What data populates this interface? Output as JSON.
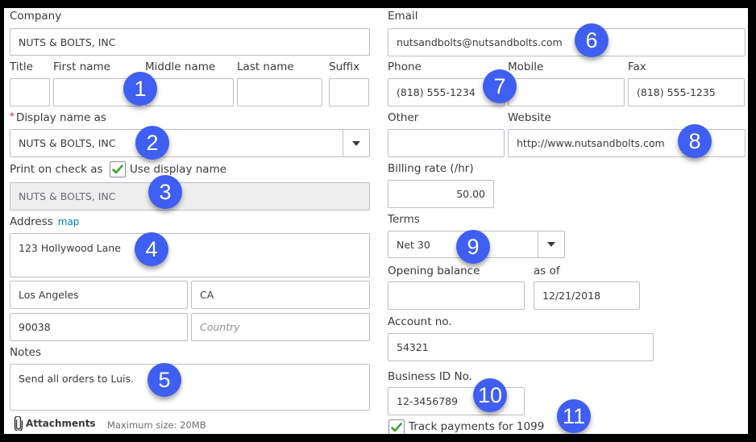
{
  "left": {
    "company": {
      "label": "Company",
      "value": "NUTS & BOLTS, INC"
    },
    "name_labels": {
      "title": "Title",
      "first": "First name",
      "middle": "Middle name",
      "last": "Last name",
      "suffix": "Suffix"
    },
    "name_values": {
      "title": "",
      "first": "",
      "middle": "",
      "last": "",
      "suffix": ""
    },
    "display_name": {
      "required_mark": "*",
      "label": "Display name as",
      "value": "NUTS & BOLTS, INC"
    },
    "print_on_check": {
      "label": "Print on check as",
      "checkbox_checked": true,
      "checkbox_label": "Use display name",
      "value": "NUTS & BOLTS, INC"
    },
    "address": {
      "label": "Address",
      "map_link": "map",
      "street": "123 Hollywood Lane",
      "city": "Los Angeles",
      "state": "CA",
      "zip": "90038",
      "country_placeholder": "Country"
    },
    "notes": {
      "label": "Notes",
      "value": "Send all orders to Luis."
    },
    "attachments": {
      "label": "Attachments",
      "max_size": "Maximum size: 20MB"
    }
  },
  "right": {
    "email": {
      "label": "Email",
      "value": "nutsandbolts@nutsandbolts.com"
    },
    "phone": {
      "label": "Phone",
      "value": "(818) 555-1234"
    },
    "mobile": {
      "label": "Mobile",
      "value": ""
    },
    "fax": {
      "label": "Fax",
      "value": "(818) 555-1235"
    },
    "other": {
      "label": "Other",
      "value": ""
    },
    "website": {
      "label": "Website",
      "value": "http://www.nutsandbolts.com"
    },
    "billing_rate": {
      "label": "Billing rate (/hr)",
      "value": "50.00"
    },
    "terms": {
      "label": "Terms",
      "value": "Net 30"
    },
    "opening_balance": {
      "label": "Opening balance",
      "value": ""
    },
    "as_of": {
      "label": "as of",
      "value": "12/21/2018"
    },
    "account_no": {
      "label": "Account no.",
      "value": "54321"
    },
    "business_id": {
      "label": "Business ID No.",
      "value": "12-3456789"
    },
    "track_1099": {
      "checked": true,
      "label": "Track payments for 1099"
    }
  },
  "callouts": [
    "1",
    "2",
    "3",
    "4",
    "5",
    "6",
    "7",
    "8",
    "9",
    "10",
    "11"
  ],
  "colors": {
    "callout": "#3f5ef2",
    "check": "#2ca01c",
    "link": "#0077c5",
    "required": "#d52b1e"
  }
}
